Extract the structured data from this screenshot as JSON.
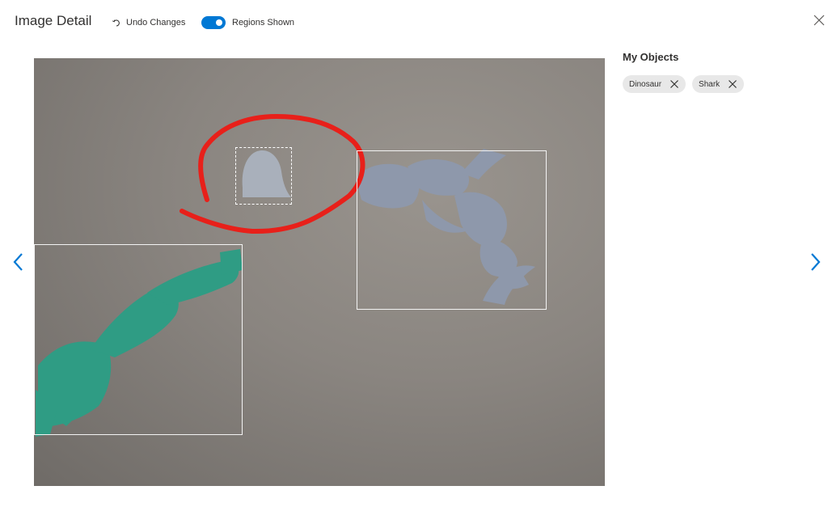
{
  "header": {
    "title": "Image Detail",
    "undo_label": "Undo Changes",
    "regions_label": "Regions Shown",
    "regions_on": true
  },
  "colors": {
    "accent": "#0078d4",
    "annotation": "#e8201a"
  },
  "icons": {
    "undo": "undo-icon",
    "close": "close-icon",
    "prev": "chevron-left-icon",
    "next": "chevron-right-icon",
    "remove": "remove-tag-icon"
  },
  "sidebar": {
    "title": "My Objects",
    "tags": [
      {
        "label": "Dinosaur"
      },
      {
        "label": "Shark"
      }
    ]
  }
}
